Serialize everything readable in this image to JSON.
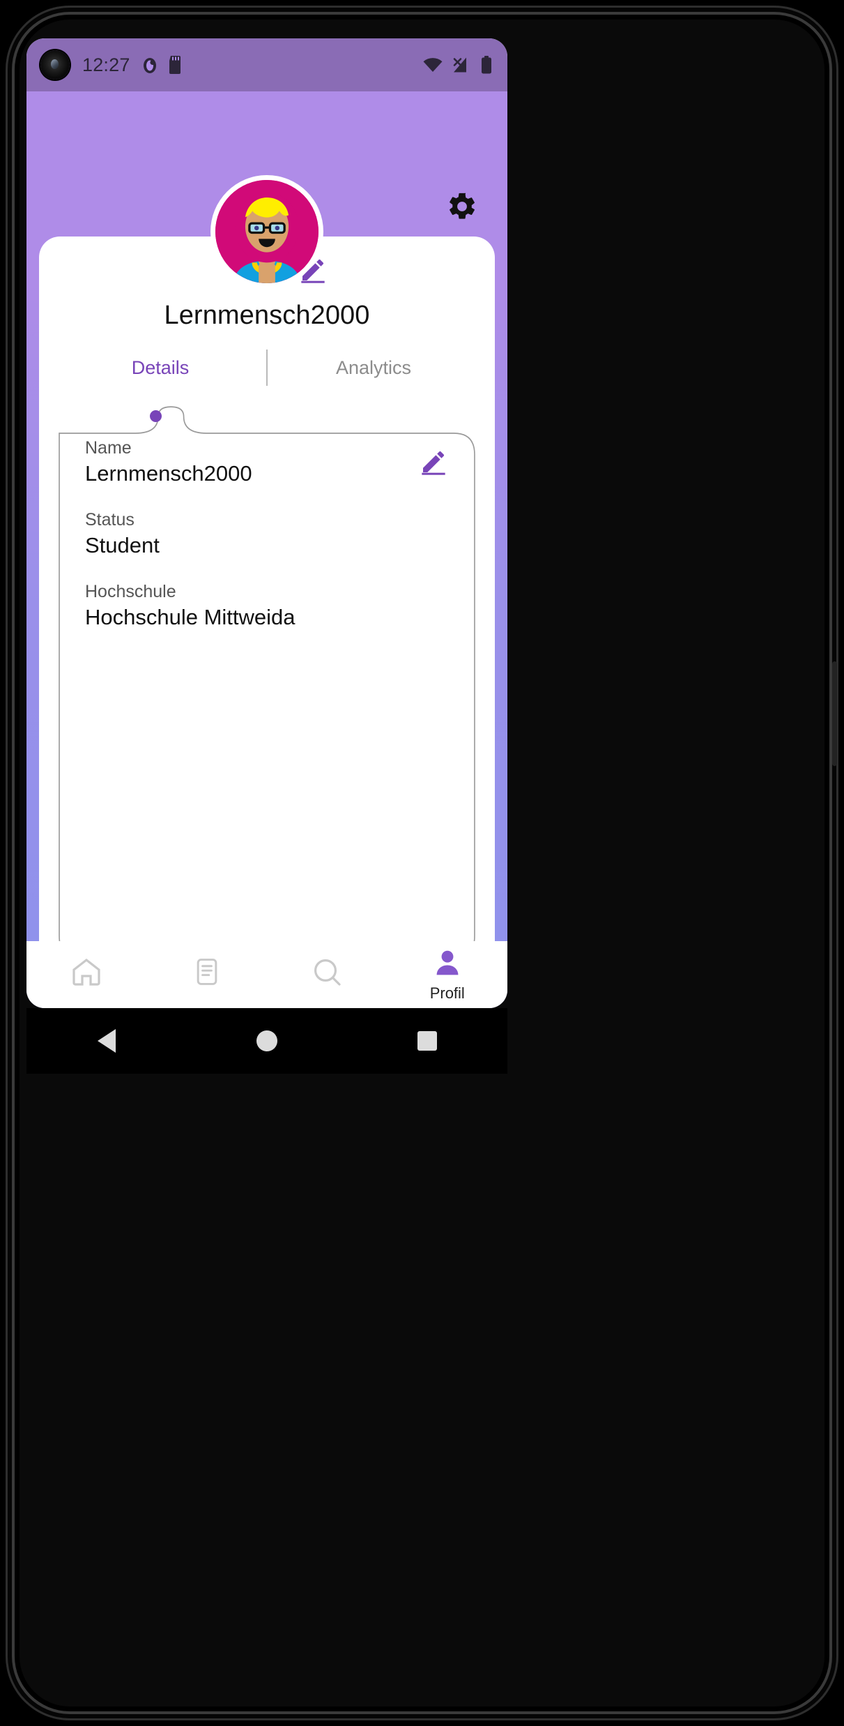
{
  "status_bar": {
    "time": "12:27",
    "left_icons": [
      "alarm-icon",
      "sd-card-icon"
    ],
    "right_icons": [
      "wifi-icon",
      "signal-no-service-icon",
      "battery-full-icon"
    ]
  },
  "header": {
    "settings_icon": "gear-icon",
    "background_color": "#AF8CE8",
    "avatar": {
      "icon_name": "user-avatar",
      "edit_icon": "pencil-edit-icon",
      "hair_color": "#D10A78",
      "bangs_color": "#FFEE00",
      "skin_color": "#D9A26C",
      "shirt_color": "#11A0E0",
      "necklace_color": "#FFD100",
      "glasses_color": "#A7DCE8"
    }
  },
  "profile": {
    "username": "Lernmensch2000",
    "accent_color": "#7844B8"
  },
  "tabs": [
    {
      "label": "Details",
      "active": true
    },
    {
      "label": "Analytics",
      "active": false
    }
  ],
  "details": {
    "edit_icon": "pencil-edit-icon",
    "fields": [
      {
        "label": "Name",
        "value": "Lernmensch2000"
      },
      {
        "label": "Status",
        "value": "Student"
      },
      {
        "label": "Hochschule",
        "value": "Hochschule Mittweida"
      }
    ]
  },
  "bottom_nav": [
    {
      "label": "",
      "icon": "home-icon",
      "active": false
    },
    {
      "label": "",
      "icon": "document-icon",
      "active": false
    },
    {
      "label": "",
      "icon": "search-icon",
      "active": false
    },
    {
      "label": "Profil",
      "icon": "person-icon",
      "active": true
    }
  ],
  "android_nav": [
    {
      "icon": "back-triangle-icon"
    },
    {
      "icon": "home-circle-icon"
    },
    {
      "icon": "recents-square-icon"
    }
  ]
}
